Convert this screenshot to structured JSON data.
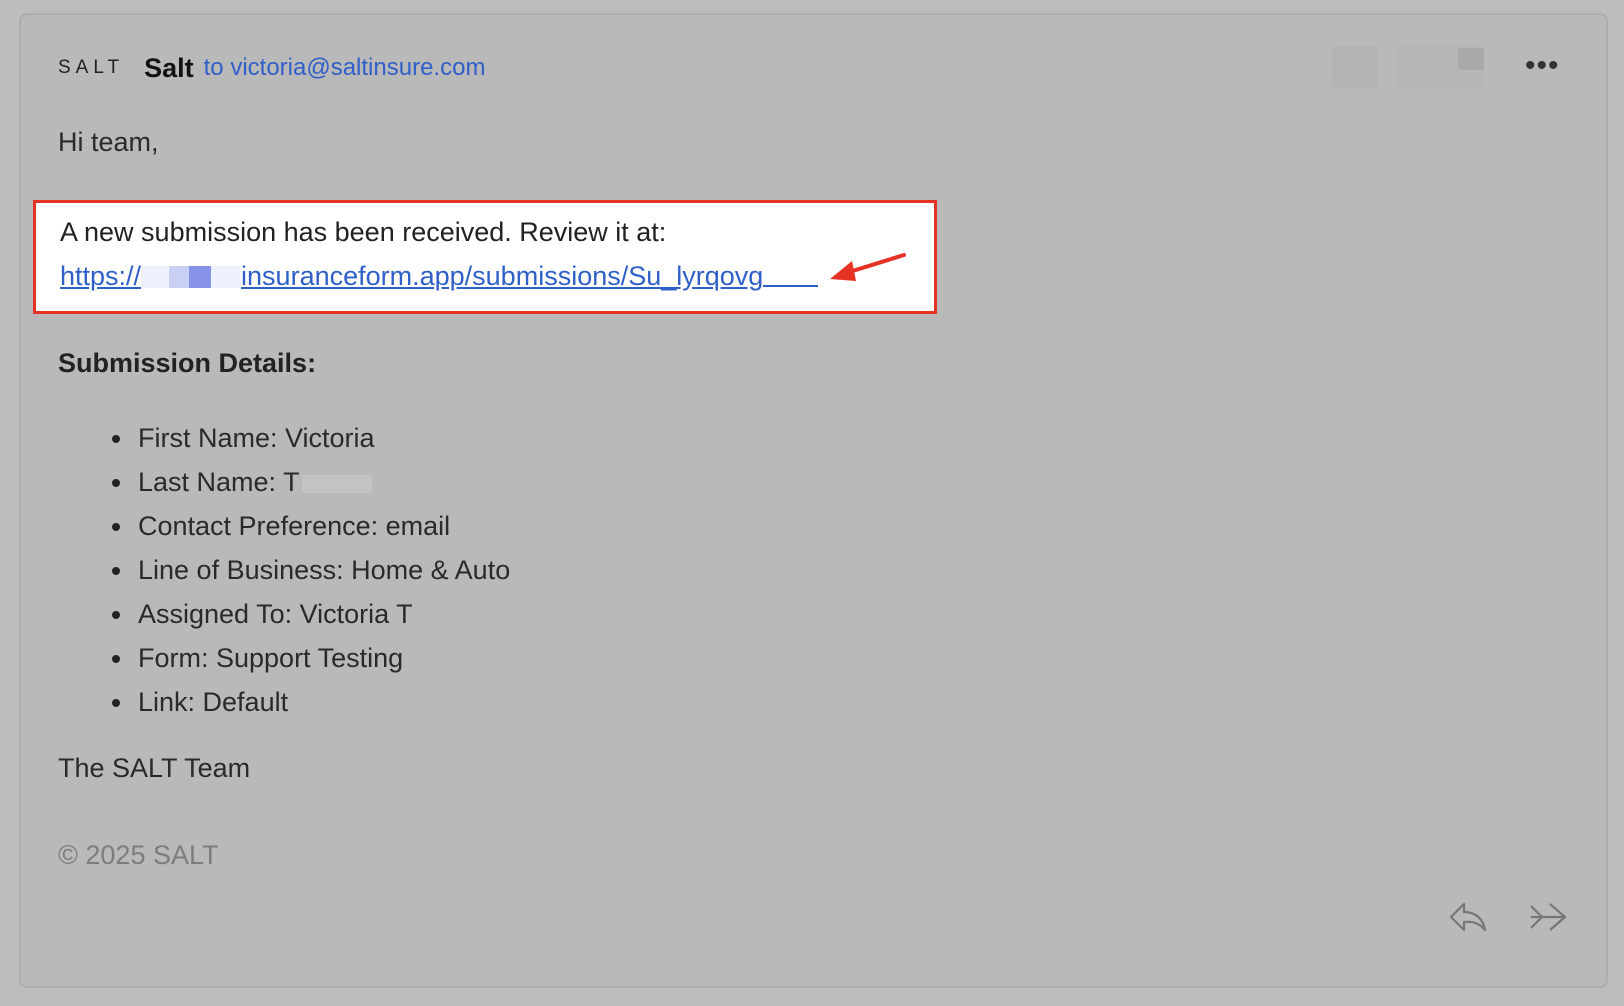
{
  "header": {
    "logo_text": "SALT",
    "sender": "Salt",
    "recipient_line": "to victoria@saltinsure.com",
    "more_label": "•••"
  },
  "body": {
    "greeting": "Hi team,",
    "review_text": "A new submission has been received. Review it at:",
    "link_prefix": "https://",
    "link_suffix": "insuranceform.app/submissions/Su_lyrqovg",
    "details_title": "Submission Details:",
    "details": [
      "First Name: Victoria",
      "Last Name: T",
      "Contact Preference: email",
      "Line of Business: Home & Auto",
      "Assigned To: Victoria T",
      "Form: Support Testing",
      "Link: Default"
    ],
    "signoff": "The SALT Team",
    "copyright": "© 2025 SALT"
  },
  "icons": {
    "reply": "reply-icon",
    "forward": "forward-icon",
    "more": "more-options-icon",
    "annotation": "red-arrow-icon"
  },
  "colors": {
    "link": "#2f5fc8",
    "highlight_border": "#e53224",
    "background": "#bdbdbd"
  }
}
